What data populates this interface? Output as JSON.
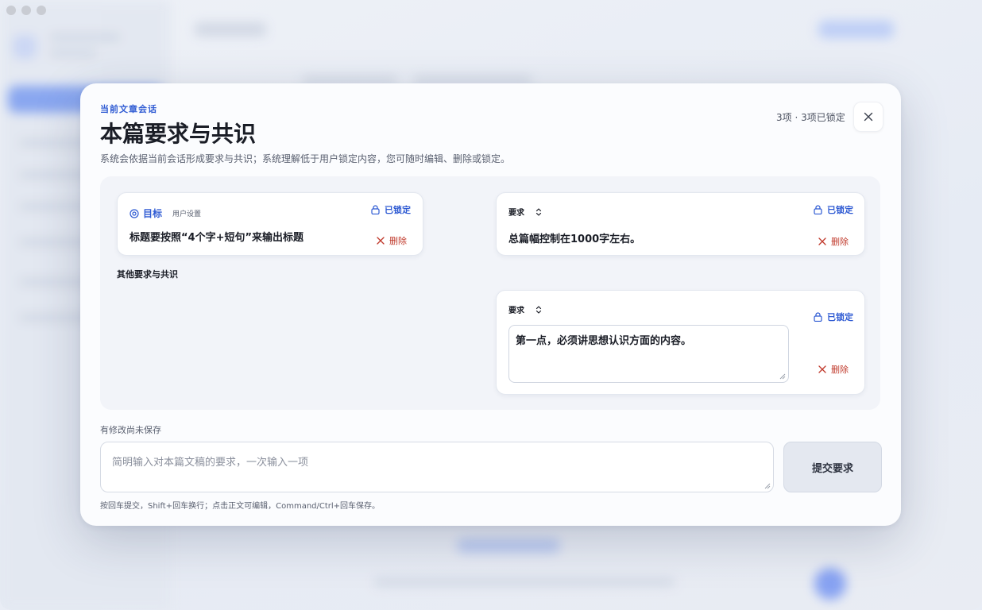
{
  "modal": {
    "eyebrow": "当前文章会话",
    "title": "本篇要求与共识",
    "description": "系统会依据当前会话形成要求与共识；系统理解低于用户锁定内容，您可随时编辑、删除或锁定。",
    "counter": "3项 · 3项已锁定",
    "close_icon": "close-icon"
  },
  "cards": [
    {
      "type_label": "目标",
      "type_icon": "target-icon",
      "source": "用户设置",
      "text": "标题要按照“4个字+短句”来输出标题",
      "lock_label": "已锁定",
      "delete_label": "删除"
    },
    {
      "type_label": "要求",
      "text": "总篇幅控制在1000字左右。",
      "lock_label": "已锁定",
      "delete_label": "删除"
    },
    {
      "type_label": "要求",
      "text": "第一点，必须讲思想认识方面的内容。",
      "lock_label": "已锁定",
      "delete_label": "删除"
    }
  ],
  "group_heading": "其他要求与共识",
  "footer": {
    "unsaved": "有修改尚未保存",
    "input_placeholder": "简明输入对本篇文稿的要求，一次输入一项",
    "submit_label": "提交要求",
    "hint": "按回车提交，Shift+回车换行；点击正文可编辑，Command/Ctrl+回车保存。"
  },
  "colors": {
    "accent": "#2f5bd3",
    "danger": "#c0392b",
    "text": "#1a1d26"
  }
}
